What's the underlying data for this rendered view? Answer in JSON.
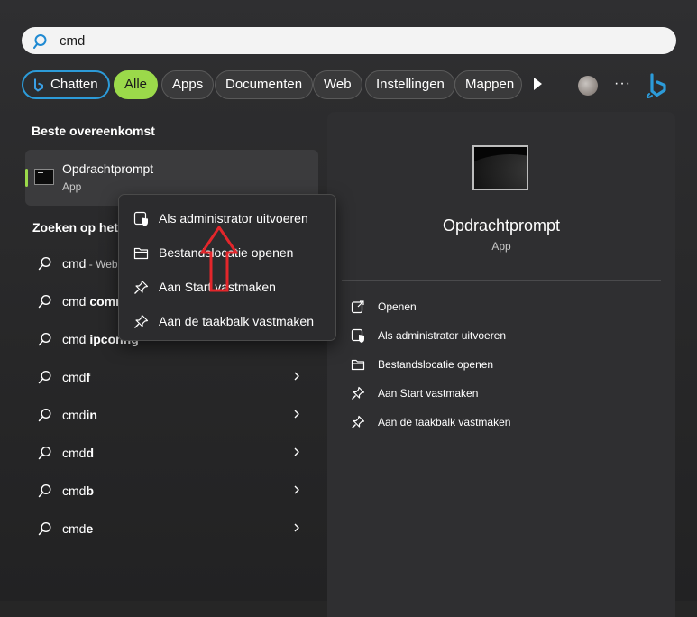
{
  "search": {
    "query": "cmd"
  },
  "filters": {
    "chips": [
      "Chatten",
      "Alle",
      "Apps",
      "Documenten",
      "Web",
      "Instellingen",
      "Mappen"
    ],
    "more_label": "···"
  },
  "best_match": {
    "heading": "Beste overeenkomst",
    "name": "Opdrachtprompt",
    "type": "App"
  },
  "web_search": {
    "heading": "Zoeken op het",
    "results": [
      {
        "prefix": "cmd",
        "bold": "",
        "suffix": " - Web",
        "chevron": false
      },
      {
        "prefix": "cmd ",
        "bold": "comm",
        "suffix": "",
        "chevron": false
      },
      {
        "prefix": "cmd ",
        "bold": "ipconfig",
        "suffix": "",
        "chevron": false
      },
      {
        "prefix": "cmd",
        "bold": "f",
        "suffix": "",
        "chevron": true
      },
      {
        "prefix": "cmd",
        "bold": "in",
        "suffix": "",
        "chevron": true
      },
      {
        "prefix": "cmd",
        "bold": "d",
        "suffix": "",
        "chevron": true
      },
      {
        "prefix": "cmd",
        "bold": "b",
        "suffix": "",
        "chevron": true
      },
      {
        "prefix": "cmd",
        "bold": "e",
        "suffix": "",
        "chevron": true
      }
    ]
  },
  "context_menu": {
    "items": [
      {
        "label": "Als administrator uitvoeren",
        "icon": "shield-icon"
      },
      {
        "label": "Bestandslocatie openen",
        "icon": "folder-icon"
      },
      {
        "label": "Aan Start vastmaken",
        "icon": "pin-icon"
      },
      {
        "label": "Aan de taakbalk vastmaken",
        "icon": "pin-icon"
      }
    ]
  },
  "detail_panel": {
    "title": "Opdrachtprompt",
    "subtitle": "App",
    "actions": [
      {
        "label": "Openen",
        "icon": "open-icon"
      },
      {
        "label": "Als administrator uitvoeren",
        "icon": "shield-icon"
      },
      {
        "label": "Bestandslocatie openen",
        "icon": "folder-icon"
      },
      {
        "label": "Aan Start vastmaken",
        "icon": "pin-icon"
      },
      {
        "label": "Aan de taakbalk vastmaken",
        "icon": "pin-icon"
      }
    ]
  },
  "colors": {
    "accent_green": "#9bd94a",
    "bing_blue": "#2c9bd9",
    "annotation_red": "#e3262b"
  }
}
